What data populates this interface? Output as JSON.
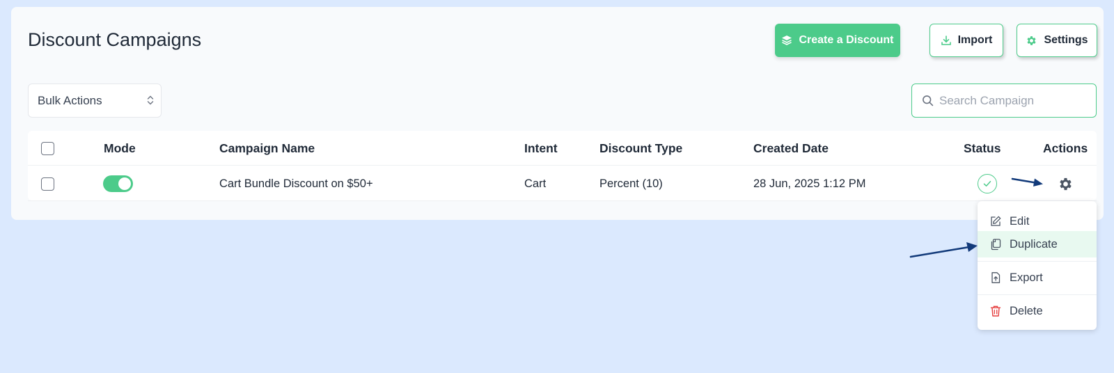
{
  "header": {
    "title": "Discount Campaigns",
    "create_label": "Create a Discount",
    "import_label": "Import",
    "settings_label": "Settings"
  },
  "toolbar": {
    "bulk_actions_label": "Bulk Actions",
    "search_placeholder": "Search Campaign"
  },
  "table": {
    "columns": [
      "Mode",
      "Campaign Name",
      "Intent",
      "Discount Type",
      "Created Date",
      "Status",
      "Actions"
    ],
    "rows": [
      {
        "mode_enabled": true,
        "campaign_name": "Cart Bundle Discount on $50+",
        "intent": "Cart",
        "discount_type": "Percent (10)",
        "created_date": "28 Jun, 2025 1:12 PM",
        "status": "active"
      }
    ]
  },
  "actions_menu": {
    "items": [
      {
        "label": "Edit",
        "icon": "edit-icon"
      },
      {
        "label": "Duplicate",
        "icon": "duplicate-icon",
        "highlighted": true
      },
      {
        "label": "Export",
        "icon": "export-icon"
      },
      {
        "label": "Delete",
        "icon": "trash-icon",
        "danger": true
      }
    ]
  },
  "colors": {
    "accent": "#4ccb8a",
    "background": "#dbe9fe",
    "annotation_arrow": "#123a7a",
    "danger": "#e53e3e"
  }
}
